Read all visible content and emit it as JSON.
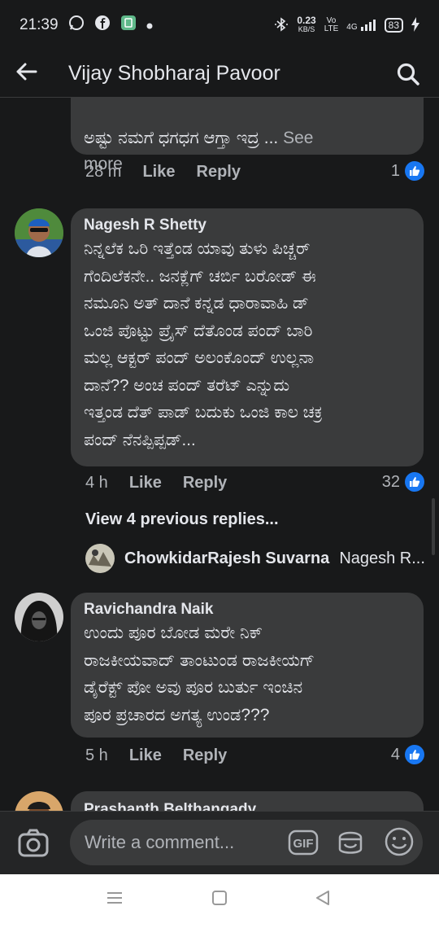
{
  "status": {
    "time": "21:39",
    "speed": "0.23",
    "speed_unit": "KB/S",
    "volte": "Vo",
    "lte": "LTE",
    "network": "4G",
    "battery": "83"
  },
  "header": {
    "title": "Vijay Shobharaj Pavoor"
  },
  "comments": [
    {
      "text_tail": "ಅಷ್ಟು ನಮಗೆ ಧಗಧಗ ಆಗ್ತಾ ಇದ್ರ ... ",
      "see_more": "See",
      "see_more_2": "more",
      "time": "28 m",
      "like": "Like",
      "reply": "Reply",
      "likes": "1"
    },
    {
      "author": "Nagesh R Shetty",
      "text": "ನಿನ್ನಲೆಕ ಒರಿ ಇತ್ತೆಂಡ ಯಾವು ತುಳು ಪಿಚ್ಚರ್\nಗೆಂದಿಲೆಕನೇ.. ಜನಕ್ಲೆಗ್ ಚರ್ಬಿ ಬರೋಡ್ ಈ\nನಮೂನಿ ಅತ್ ದಾನೆ ಕನ್ನಡ ಧಾರಾವಾಹಿ ಡ್\nಒಂಜಿ ಪೊಟ್ಟು ಪ್ರೈಸ್ ದೆತೊಂಡ ಪಂದ್ ಬಾರಿ\nಮಲ್ಲ ಆಕ್ಟರ್ ಪಂದ್ ಅಲಂಕೊಂದ್ ಉಲ್ಲನಾ\nದಾನೆ??  ಅಂಚ ಪಂದ್ ತರೆಟ್ ಎನ್ನುದು\nಇತ್ತಂಡ ದೆತ್ ಪಾಡ್ ಬದುಕು ಒಂಜಿ ಕಾಲ ಚಕ್ರ\nಪಂದ್ ನೆನಪ್ಪಿಪ್ಪಡ್...",
      "time": "4 h",
      "like": "Like",
      "reply": "Reply",
      "likes": "32",
      "view_previous": "View 4 previous replies...",
      "reply_author": "ChowkidarRajesh Suvarna",
      "reply_text": "Nagesh R..."
    },
    {
      "author": "Ravichandra Naik",
      "text": "ಉಂದು ಪೂರ ಬೋಡ ಮರೇ ನಿಕ್\nರಾಜಕೀಯವಾದ್ ತಾಂಟುಂಡ ರಾಜಕೀಯಗ್\nಡೈರೆಕ್ಟ್ ಪೋ ಅವು ಪೂರ ಬುರ್ತು ಇಂಚಿನ\nಪೂರ ಪ್ರಚಾರದ ಅಗತ್ಯ ಉಂಡ???",
      "time": "5 h",
      "like": "Like",
      "reply": "Reply",
      "likes": "4"
    },
    {
      "author": "Prashanth Belthangady"
    }
  ],
  "composer": {
    "placeholder": "Write a comment...",
    "gif": "GIF"
  },
  "colors": {
    "background": "#18191a",
    "bubble": "#3a3b3c",
    "like_blue": "#1877f2"
  }
}
